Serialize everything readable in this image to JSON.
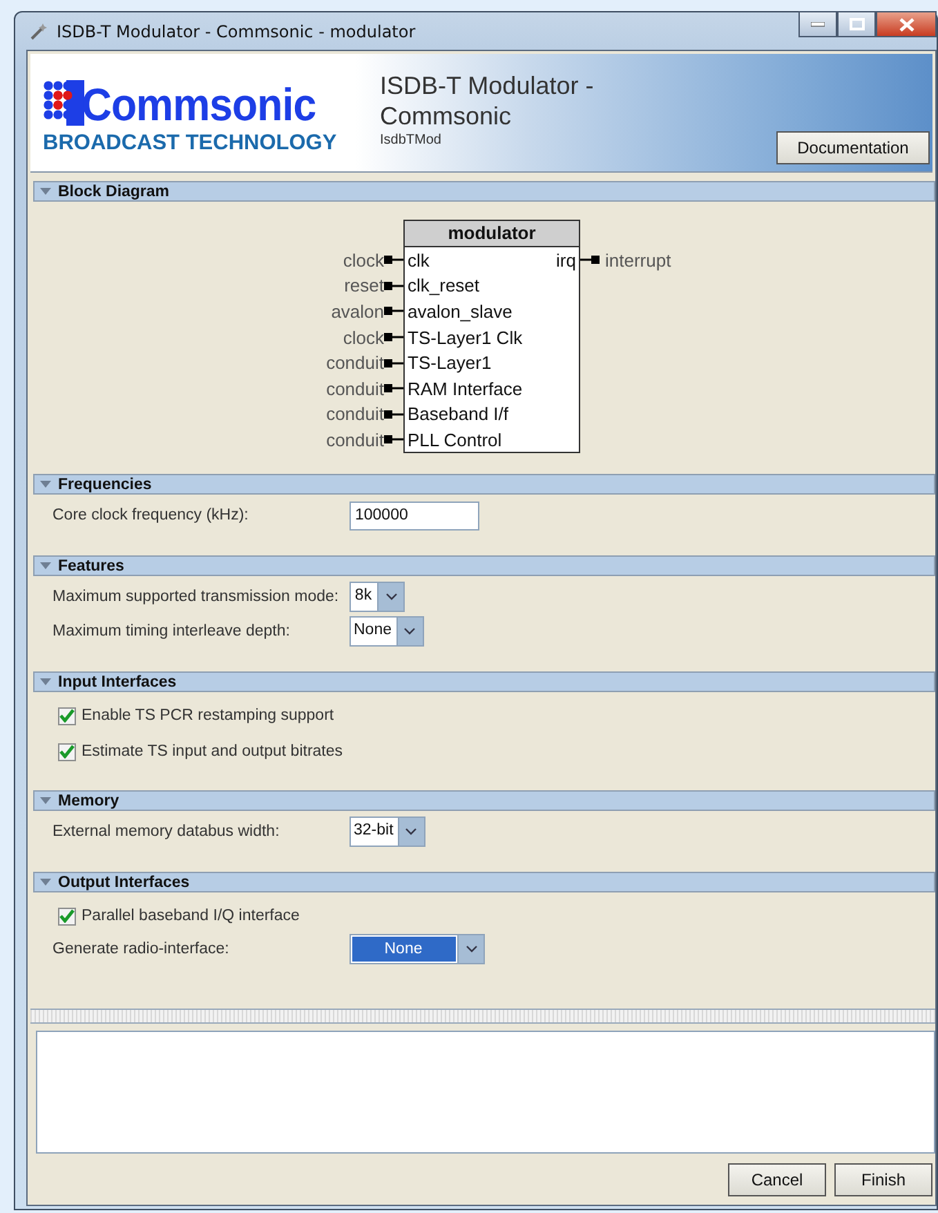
{
  "window": {
    "title": "ISDB-T Modulator - Commsonic - modulator"
  },
  "header": {
    "logo_name": "Commsonic",
    "logo_tagline": "BROADCAST TECHNOLOGY",
    "title": "ISDB-T Modulator - Commsonic",
    "subtitle": "IsdbTMod",
    "documentation_button": "Documentation"
  },
  "sections": [
    {
      "title": "Block Diagram",
      "expanded": true,
      "kind": "diagram",
      "diagram": {
        "component": "modulator",
        "inputs": [
          {
            "signal": "clock",
            "port": "clk"
          },
          {
            "signal": "reset",
            "port": "clk_reset"
          },
          {
            "signal": "avalon",
            "port": "avalon_slave"
          },
          {
            "signal": "clock",
            "port": "TS-Layer1 Clk"
          },
          {
            "signal": "conduit",
            "port": "TS-Layer1"
          },
          {
            "signal": "conduit",
            "port": "RAM Interface"
          },
          {
            "signal": "conduit",
            "port": "Baseband I/f"
          },
          {
            "signal": "conduit",
            "port": "PLL Control"
          }
        ],
        "outputs": [
          {
            "port": "irq",
            "signal": "interrupt"
          }
        ]
      }
    },
    {
      "title": "Frequencies",
      "expanded": true,
      "kind": "form",
      "rows": [
        {
          "kind": "text",
          "label": "Core clock frequency (kHz):",
          "value": "100000"
        }
      ]
    },
    {
      "title": "Features",
      "expanded": true,
      "kind": "form",
      "rows": [
        {
          "kind": "dropdown",
          "label": "Maximum supported transmission mode:",
          "value": "8k",
          "highlighted": false
        },
        {
          "kind": "dropdown",
          "label": "Maximum timing interleave depth:",
          "value": "None",
          "highlighted": false
        }
      ]
    },
    {
      "title": "Input Interfaces",
      "expanded": true,
      "kind": "form",
      "rows": [
        {
          "kind": "checkbox",
          "label": "Enable TS PCR restamping support",
          "checked": true
        },
        {
          "kind": "checkbox",
          "label": "Estimate TS input and output bitrates",
          "checked": true
        }
      ]
    },
    {
      "title": "Memory",
      "expanded": true,
      "kind": "form",
      "rows": [
        {
          "kind": "dropdown",
          "label": "External memory databus width:",
          "value": "32-bit",
          "highlighted": false
        }
      ]
    },
    {
      "title": "Output Interfaces",
      "expanded": true,
      "kind": "form",
      "rows": [
        {
          "kind": "checkbox",
          "label": "Parallel baseband I/Q interface",
          "checked": true
        },
        {
          "kind": "dropdown",
          "label": "Generate radio-interface:",
          "value": "None",
          "highlighted": true
        }
      ]
    }
  ],
  "buttons": [
    "Cancel",
    "Finish"
  ]
}
